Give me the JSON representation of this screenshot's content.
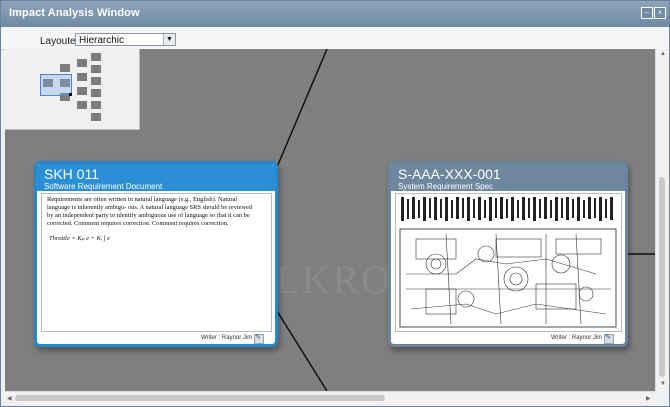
{
  "window": {
    "title": "Impact Analysis Window",
    "minimize_icon": "minimize-icon",
    "close_icon": "close-icon"
  },
  "toolbar": {
    "layouter_label": "Layouter :",
    "layouter_value": "Hierarchic"
  },
  "watermark": "LKROA",
  "cards": [
    {
      "id": "SKH 011",
      "subtitle": "Software Requirement Document",
      "body_text": "Requirements are often written in natural language (e.g., English). Natural language is inherently ambigu- ous. A natural language SRS should be reviewed by an independent party to identify ambiguous use of language so that it can be corrected. Comment requires correction. Comment requires correction.",
      "equation": "Throttle = Kₚ e + Kᵢ ∫ e",
      "writer": "Writer : Raynor Jim",
      "header_color": "#2b8fd6"
    },
    {
      "id": "S-AAA-XXX-001",
      "subtitle": "System Requirement Spec",
      "writer": "Writer : Raynor Jim",
      "header_color": "#6e869e"
    }
  ]
}
